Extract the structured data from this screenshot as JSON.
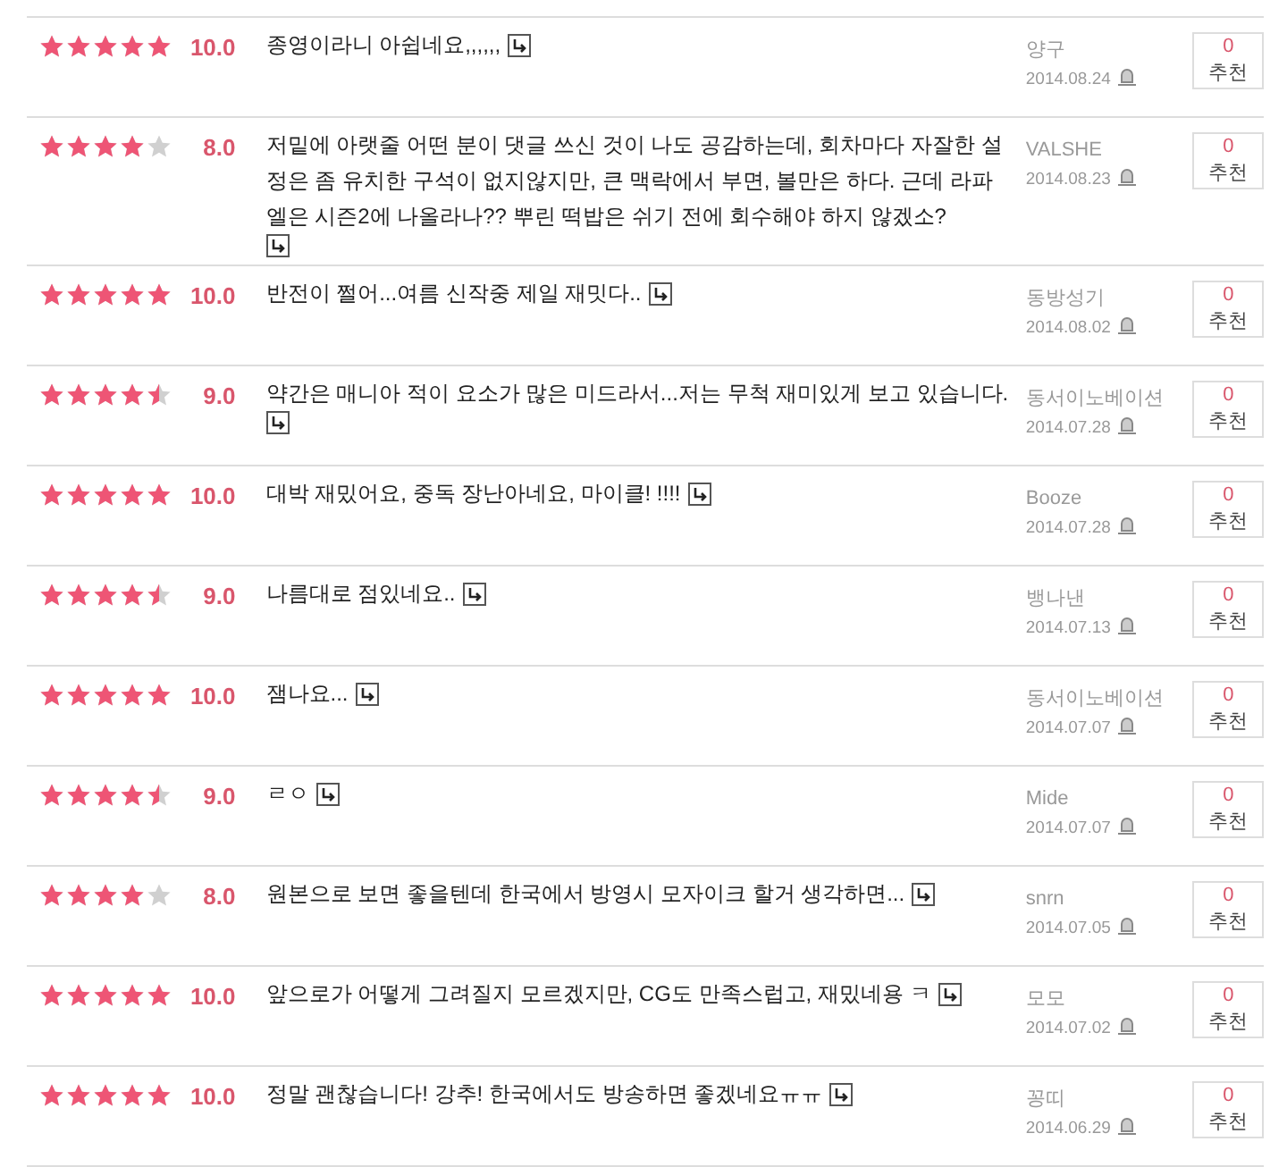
{
  "reviews": [
    {
      "stars": 5,
      "score": "10.0",
      "comment": "종영이라니 아쉽네요,,,,,,",
      "user": "양구",
      "date": "2014.08.24",
      "recommend_count": "0",
      "recommend_label": "추천"
    },
    {
      "stars": 4,
      "score": "8.0",
      "comment": "저밑에 아랫줄 어떤 분이 댓글 쓰신 것이 나도 공감하는데, 회차마다 자잘한 설정은 좀 유치한 구석이 없지않지만, 큰 맥락에서 부면, 볼만은 하다. 근데 라파엘은 시즌2에 나올라나?? 뿌린 떡밥은 쉬기 전에 회수해야 하지 않겠소?",
      "user": "VALSHE",
      "date": "2014.08.23",
      "recommend_count": "0",
      "recommend_label": "추천"
    },
    {
      "stars": 5,
      "score": "10.0",
      "comment": "반전이 쩔어...여름 신작중 제일 재밋다..",
      "user": "동방성기",
      "date": "2014.08.02",
      "recommend_count": "0",
      "recommend_label": "추천"
    },
    {
      "stars": 4.5,
      "score": "9.0",
      "comment": "약간은 매니아 적이 요소가 많은 미드라서...저는 무척 재미있게 보고 있습니다.",
      "user": "동서이노베이션",
      "date": "2014.07.28",
      "recommend_count": "0",
      "recommend_label": "추천"
    },
    {
      "stars": 5,
      "score": "10.0",
      "comment": "대박 재밌어요, 중독 장난아네요, 마이클! !!!!",
      "user": "Booze",
      "date": "2014.07.28",
      "recommend_count": "0",
      "recommend_label": "추천"
    },
    {
      "stars": 4.5,
      "score": "9.0",
      "comment": "나름대로 점있네요..",
      "user": "뱅나낸",
      "date": "2014.07.13",
      "recommend_count": "0",
      "recommend_label": "추천"
    },
    {
      "stars": 5,
      "score": "10.0",
      "comment": "잼나요...",
      "user": "동서이노베이션",
      "date": "2014.07.07",
      "recommend_count": "0",
      "recommend_label": "추천"
    },
    {
      "stars": 4.5,
      "score": "9.0",
      "comment": "ㄹㅇ",
      "user": "Mide",
      "date": "2014.07.07",
      "recommend_count": "0",
      "recommend_label": "추천"
    },
    {
      "stars": 4,
      "score": "8.0",
      "comment": "원본으로 보면 좋을텐데 한국에서 방영시 모자이크 할거 생각하면...",
      "user": "snrn",
      "date": "2014.07.05",
      "recommend_count": "0",
      "recommend_label": "추천"
    },
    {
      "stars": 5,
      "score": "10.0",
      "comment": "앞으로가 어떻게 그려질지 모르겠지만, CG도 만족스럽고, 재밌네용 ㅋ",
      "user": "모모",
      "date": "2014.07.02",
      "recommend_count": "0",
      "recommend_label": "추천"
    },
    {
      "stars": 5,
      "score": "10.0",
      "comment": "정말 괜찮습니다! 강추! 한국에서도 방송하면 좋겠네요ㅠㅠ",
      "user": "꽁띠",
      "date": "2014.06.29",
      "recommend_count": "0",
      "recommend_label": "추천"
    }
  ]
}
